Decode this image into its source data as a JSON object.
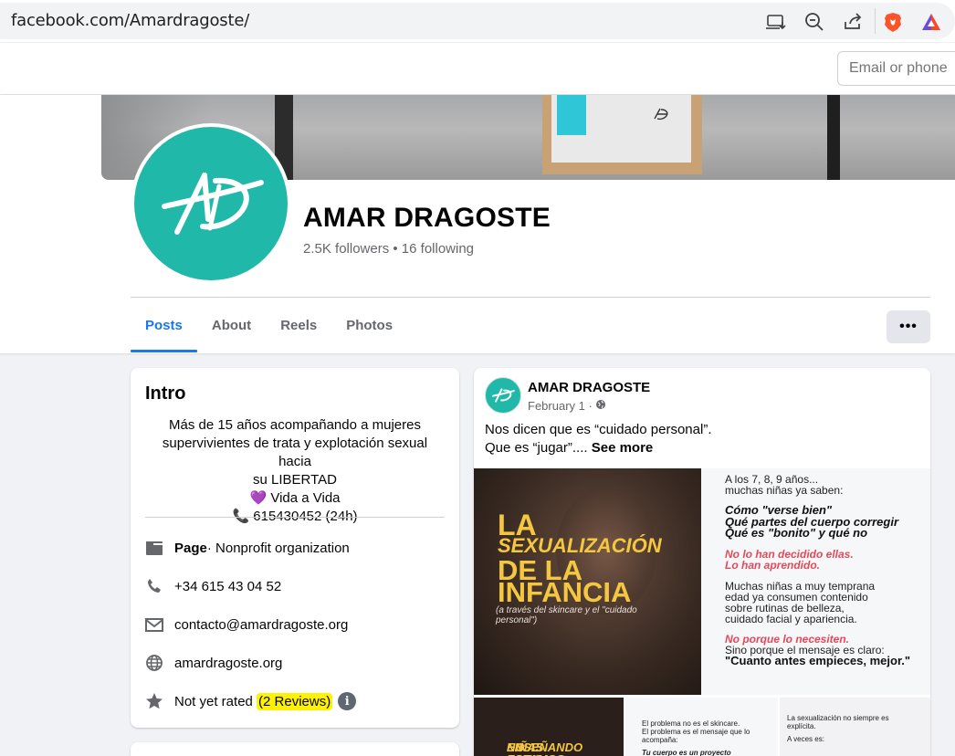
{
  "browser": {
    "url": "facebook.com/Amardragoste/"
  },
  "header": {
    "email_placeholder": "Email or phone"
  },
  "profile": {
    "name": "AMAR DRAGOSTE",
    "stats": "2.5K followers • 16 following"
  },
  "tabs": [
    {
      "label": "Posts",
      "active": true
    },
    {
      "label": "About",
      "active": false
    },
    {
      "label": "Reels",
      "active": false
    },
    {
      "label": "Photos",
      "active": false
    }
  ],
  "more_label": "•••",
  "intro": {
    "title": "Intro",
    "bio_lines": [
      "Más de 15 años acompañando a mujeres",
      "supervivientes de trata y explotación sexual hacia",
      "su LIBERTAD",
      "💜 Vida a Vida",
      "📞 615430452 (24h)"
    ],
    "page_label": "Page",
    "page_category": " · Nonprofit organization",
    "phone": "+34 615 43 04 52",
    "email": "contacto@amardragoste.org",
    "website": "amardragoste.org",
    "rating_text": "Not yet rated ",
    "reviews_text": "(2 Reviews)",
    "info_glyph": "i"
  },
  "post": {
    "author": "AMAR DRAGOSTE",
    "date": "February 1 · ",
    "text_line1": "Nos dicen que es “cuidado personal”.",
    "text_line2": "Que es “jugar”.... ",
    "see_more": "See more",
    "image_left": {
      "line1": "LA",
      "line2": "SEXUALIZACIÓN",
      "line3": "DE LA",
      "line4": "INFANCIA",
      "subtitle": "(a través del skincare y el \"cuidado personal\")"
    },
    "image_right": {
      "intro1": "A los 7, 8, 9 años...",
      "intro2": "muchas niñas ya saben:",
      "b1": "Cómo \"verse bien\"",
      "b2": "Qué partes del cuerpo corregir",
      "b3": "Qué es \"bonito\" y qué no",
      "r1": "No lo han decidido ellas.",
      "r2": "Lo han aprendido.",
      "p1": "Muchas niñas a muy temprana",
      "p2": "edad ya consumen contenido",
      "p3": "sobre rutinas de belleza,",
      "p4": "cuidado facial y apariencia.",
      "r3": "No porque lo necesiten.",
      "p5": "Sino porque el mensaje es claro:",
      "b4": "\"Cuanto antes empieces, mejor.\""
    },
    "image_bottom": {
      "left_l1": "NO ESTAMOS",
      "left_l2": "ENSEÑANDO A LAS",
      "left_l3": "NIÑAS A",
      "mid_l1": "El problema no es el skincare.",
      "mid_l2": "El problema es el mensaje que lo",
      "mid_l3": "acompaña:",
      "mid_l4": "Tu cuerpo es un proyecto",
      "right_l1": "La sexualización no siempre es",
      "right_l2": "explícita.",
      "right_l3": "A veces es:"
    }
  }
}
